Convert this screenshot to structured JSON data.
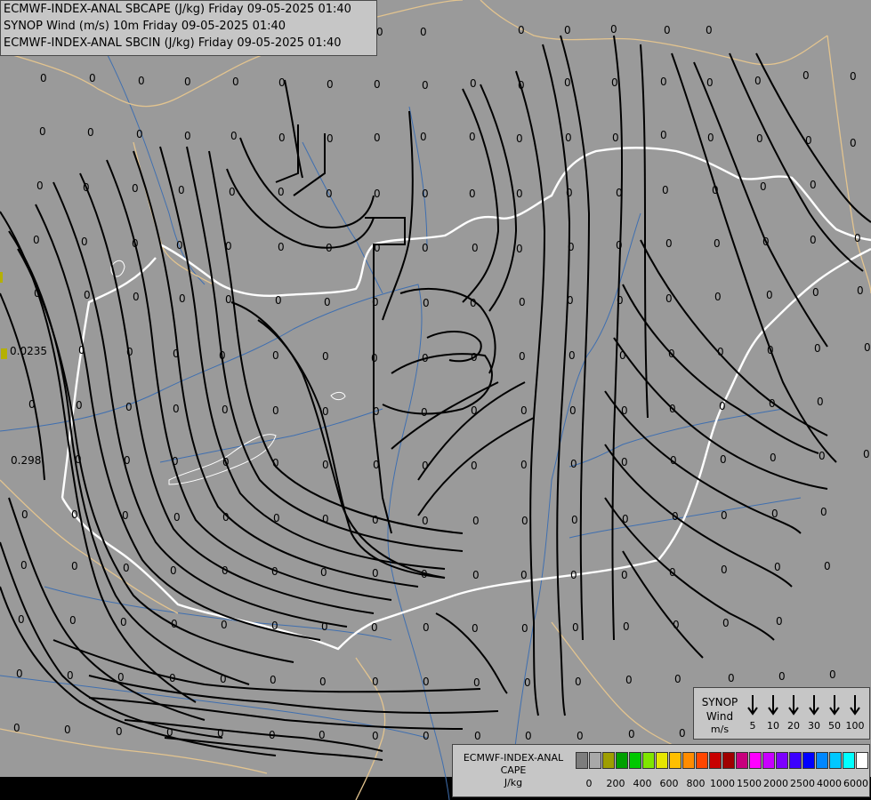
{
  "header": {
    "line1": "ECMWF-INDEX-ANAL SBCAPE (J/kg) Friday 09-05-2025 01:40",
    "line2": "SYNOP Wind (m/s) 10m Friday 09-05-2025 01:40",
    "line3": "ECMWF-INDEX-ANAL SBCIN (J/kg) Friday 09-05-2025 01:40"
  },
  "colors": {
    "map_background": "#9a9a9a",
    "streamline": "#000000",
    "national_border": "#ffffff",
    "neighbour_border": "#e3c48f",
    "rivers": "#3f6fb0",
    "panel": "#c6c6c6"
  },
  "station_values": {
    "default_value": "0",
    "special": [
      "0.0235",
      "0.298"
    ]
  },
  "synop_legend": {
    "title_line1": "SYNOP",
    "title_line2": "Wind",
    "units": "m/s",
    "arrow_icon": "down-arrow-icon",
    "speeds": [
      "5",
      "10",
      "20",
      "30",
      "50",
      "100"
    ]
  },
  "cape_legend": {
    "title_line1": "ECMWF-INDEX-ANAL",
    "title_line2": "CAPE",
    "units": "J/kg",
    "swatches": [
      "#7d7d7d",
      "#a8a8a8",
      "#9e9e00",
      "#00a000",
      "#00c800",
      "#7fe600",
      "#e6e600",
      "#ffbf00",
      "#ff8c00",
      "#ff4600",
      "#c80000",
      "#a00000",
      "#c8007d",
      "#ff00ff",
      "#c800ff",
      "#7d00ff",
      "#3c00ff",
      "#0000ff",
      "#0087ff",
      "#00c8ff",
      "#00ffff",
      "#ffffff"
    ],
    "ticks": [
      "0",
      "200",
      "400",
      "600",
      "800",
      "1000",
      "1500",
      "2000",
      "2500",
      "4000",
      "6000"
    ]
  }
}
